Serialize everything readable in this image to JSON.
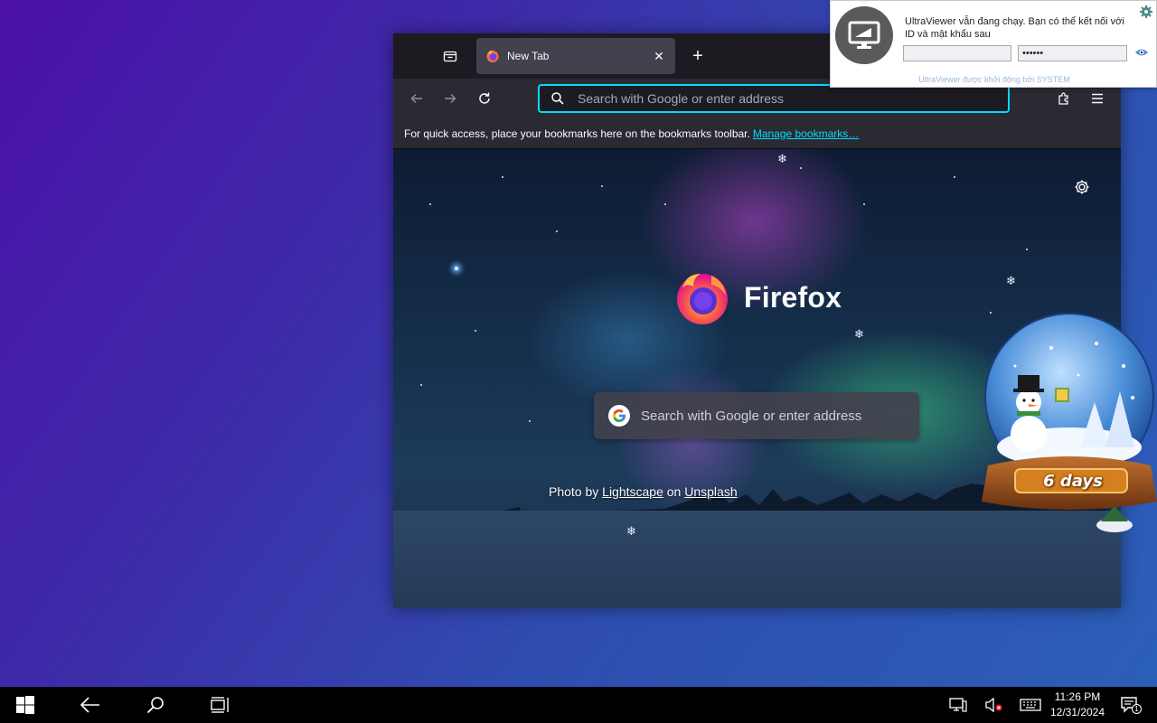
{
  "firefox": {
    "tab": {
      "title": "New Tab",
      "close_glyph": "✕"
    },
    "new_tab_glyph": "+",
    "urlbar": {
      "placeholder": "Search with Google or enter address"
    },
    "bookmarks_bar": {
      "text": "For quick access, place your bookmarks here on the bookmarks toolbar.",
      "link": "Manage bookmarks…"
    },
    "newtab": {
      "wordmark": "Firefox",
      "search_placeholder": "Search with Google or enter address",
      "credit_prefix": "Photo by",
      "credit_author": "Lightscape",
      "credit_on": "on",
      "credit_site": "Unsplash"
    },
    "snowflake_glyph": "❄"
  },
  "snowglobe": {
    "label": "6 days"
  },
  "ultraviewer": {
    "message": "UltraViewer vẫn đang chạy. Bạn có thể kết nối với ID và mật khẩu sau",
    "id_value": "",
    "password_value": "••••••",
    "footer": "UltraViewer được khởi động bởi SYSTEM"
  },
  "taskbar": {
    "time": "11:26 PM",
    "date": "12/31/2024",
    "notification_count": "1"
  },
  "colors": {
    "accent": "#00ddff",
    "toolbar": "#2b2a33",
    "tabstrip": "#1c1b22",
    "tab_active": "#42414d"
  }
}
